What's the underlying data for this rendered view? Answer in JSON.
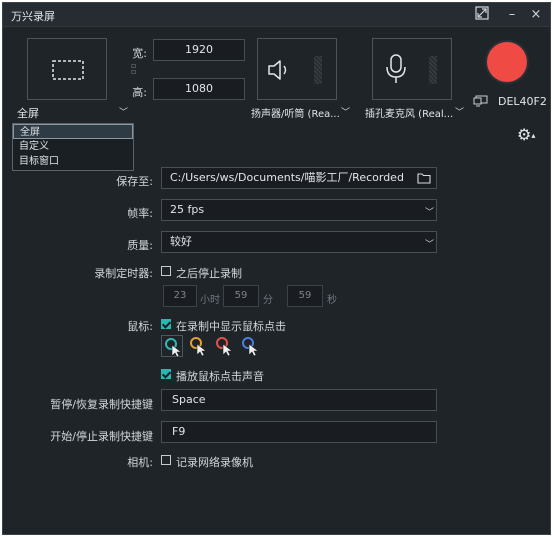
{
  "window": {
    "title": "万兴录屏"
  },
  "titlebar": {
    "maximize_icon": "fullscreen-icon",
    "minimize": "–",
    "close": "×"
  },
  "capture": {
    "width_label": "宽:",
    "width_value": "1920",
    "height_label": "高:",
    "height_value": "1080",
    "area_label": "全屏"
  },
  "audio": {
    "speaker_label": "扬声器/听筒 (Rea...",
    "mic_label": "插孔麦克风 (Real..."
  },
  "record": {
    "monitor_label": "DEL40F2"
  },
  "area_menu": {
    "items": [
      "全屏",
      "自定义",
      "目标窗口"
    ],
    "selected": "全屏"
  },
  "settings": {
    "save_to_label": "保存至:",
    "save_to_value": "C:/Users/ws/Documents/喵影工厂/Recorded",
    "fps_label": "帧率:",
    "fps_value": "25 fps",
    "quality_label": "质量:",
    "quality_value": "较好",
    "timer_label": "录制定时器:",
    "timer_checkbox_label": "之后停止录制",
    "timer_checked": false,
    "timer_hours": "23",
    "timer_hours_unit": "小时",
    "timer_minutes": "59",
    "timer_minutes_unit": "分",
    "timer_seconds": "59",
    "timer_seconds_unit": "秒",
    "mouse_label": "鼠标:",
    "show_clicks_label": "在录制中显示鼠标点击",
    "show_clicks_checked": true,
    "cursor_colors": [
      "#2fb9b3",
      "#e2a12e",
      "#e2524a",
      "#4a7ee0"
    ],
    "click_sound_label": "播放鼠标点击声音",
    "click_sound_checked": true,
    "pause_hotkey_label": "暂停/恢复录制快捷键",
    "pause_hotkey_value": "Space",
    "start_hotkey_label": "开始/停止录制快捷键",
    "start_hotkey_value": "F9",
    "camera_label": "相机:",
    "camera_checkbox_label": "记录网络录像机",
    "camera_checked": false
  },
  "colors": {
    "record": "#f04a45",
    "accent": "#2bb7b1",
    "background": "#1f2429"
  }
}
